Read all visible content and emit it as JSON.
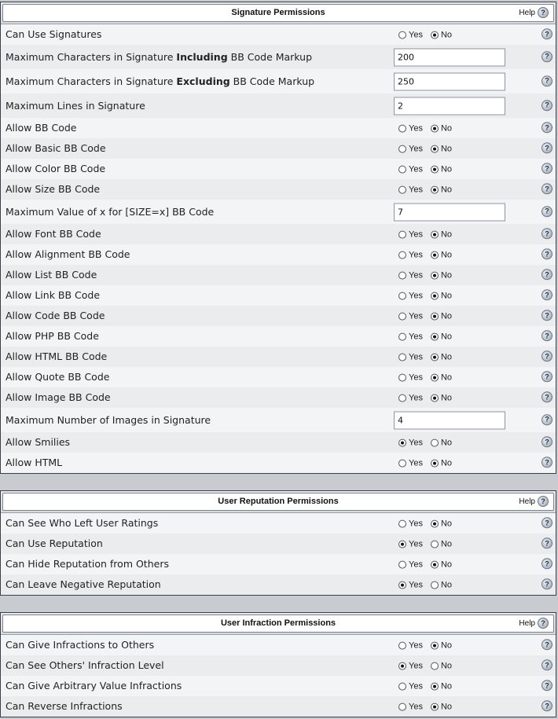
{
  "help_label": "Help",
  "yes_label": "Yes",
  "no_label": "No",
  "sections": {
    "signature": {
      "title": "Signature Permissions",
      "rows": [
        {
          "label": "Can Use Signatures",
          "type": "radio",
          "value": "no"
        },
        {
          "label_parts": [
            "Maximum Characters in Signature ",
            "Including",
            " BB Code Markup"
          ],
          "type": "text",
          "value": "200"
        },
        {
          "label_parts": [
            "Maximum Characters in Signature ",
            "Excluding",
            " BB Code Markup"
          ],
          "type": "text",
          "value": "250"
        },
        {
          "label": "Maximum Lines in Signature",
          "type": "text",
          "value": "2"
        },
        {
          "label": "Allow BB Code",
          "type": "radio",
          "value": "no"
        },
        {
          "label": "Allow Basic BB Code",
          "type": "radio",
          "value": "no"
        },
        {
          "label": "Allow Color BB Code",
          "type": "radio",
          "value": "no"
        },
        {
          "label": "Allow Size BB Code",
          "type": "radio",
          "value": "no"
        },
        {
          "label": "Maximum Value of x for [SIZE=x] BB Code",
          "type": "text",
          "value": "7"
        },
        {
          "label": "Allow Font BB Code",
          "type": "radio",
          "value": "no"
        },
        {
          "label": "Allow Alignment BB Code",
          "type": "radio",
          "value": "no"
        },
        {
          "label": "Allow List BB Code",
          "type": "radio",
          "value": "no"
        },
        {
          "label": "Allow Link BB Code",
          "type": "radio",
          "value": "no"
        },
        {
          "label": "Allow Code BB Code",
          "type": "radio",
          "value": "no"
        },
        {
          "label": "Allow PHP BB Code",
          "type": "radio",
          "value": "no"
        },
        {
          "label": "Allow HTML BB Code",
          "type": "radio",
          "value": "no"
        },
        {
          "label": "Allow Quote BB Code",
          "type": "radio",
          "value": "no"
        },
        {
          "label": "Allow Image BB Code",
          "type": "radio",
          "value": "no"
        },
        {
          "label": "Maximum Number of Images in Signature",
          "type": "text",
          "value": "4"
        },
        {
          "label": "Allow Smilies",
          "type": "radio",
          "value": "yes"
        },
        {
          "label": "Allow HTML",
          "type": "radio",
          "value": "no"
        }
      ]
    },
    "reputation": {
      "title": "User Reputation Permissions",
      "rows": [
        {
          "label": "Can See Who Left User Ratings",
          "type": "radio",
          "value": "no"
        },
        {
          "label": "Can Use Reputation",
          "type": "radio",
          "value": "yes"
        },
        {
          "label": "Can Hide Reputation from Others",
          "type": "radio",
          "value": "no"
        },
        {
          "label": "Can Leave Negative Reputation",
          "type": "radio",
          "value": "yes"
        }
      ]
    },
    "infraction": {
      "title": "User Infraction Permissions",
      "rows": [
        {
          "label": "Can Give Infractions to Others",
          "type": "radio",
          "value": "no"
        },
        {
          "label": "Can See Others' Infraction Level",
          "type": "radio",
          "value": "yes"
        },
        {
          "label": "Can Give Arbitrary Value Infractions",
          "type": "radio",
          "value": "no"
        },
        {
          "label": "Can Reverse Infractions",
          "type": "radio",
          "value": "no"
        }
      ]
    }
  }
}
